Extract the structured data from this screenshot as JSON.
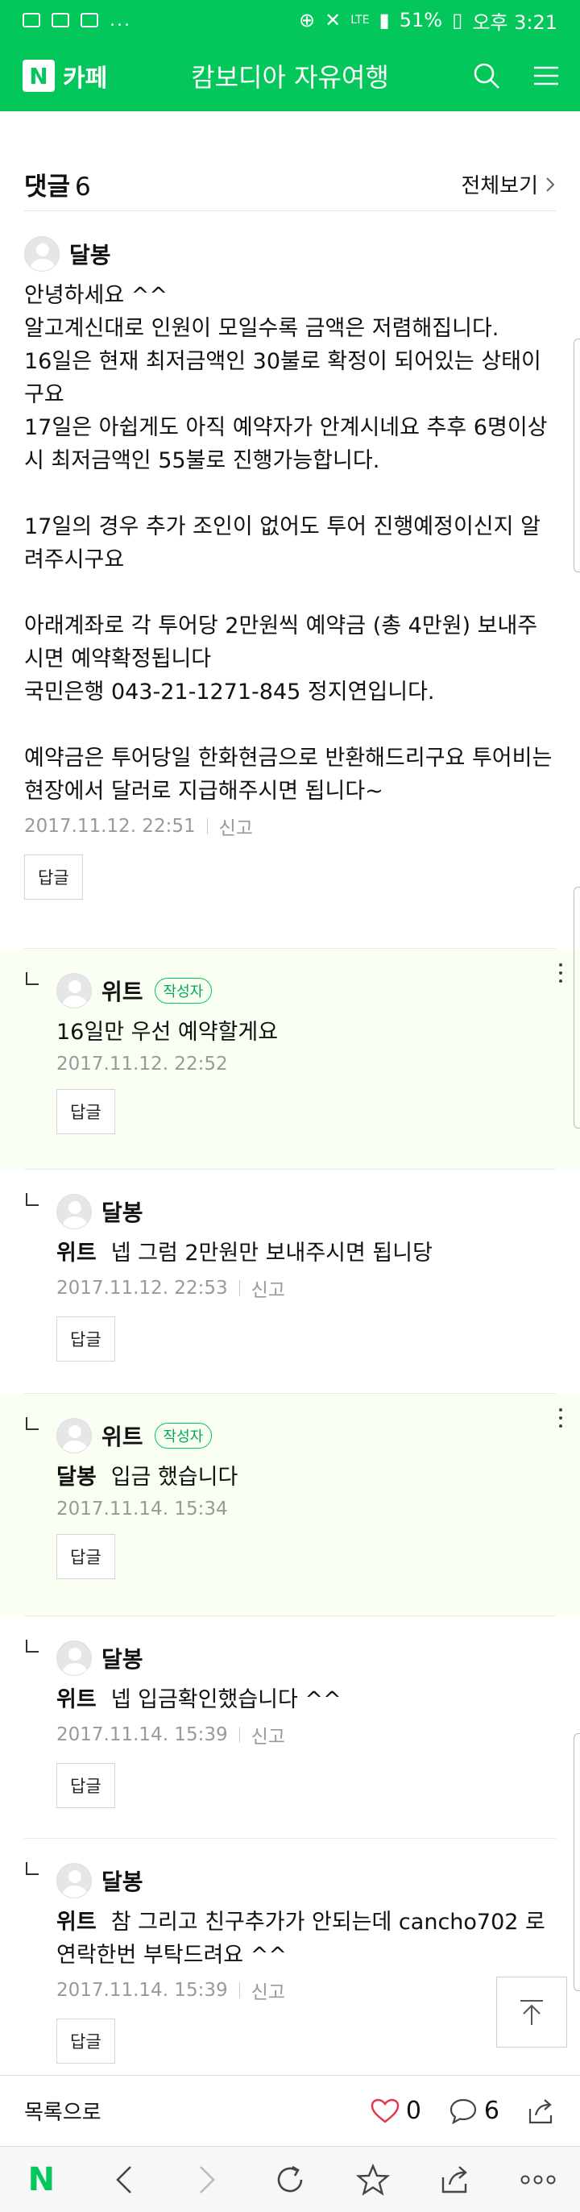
{
  "status_bar": {
    "dots": "...",
    "battery": "51%",
    "time": "오후 3:21",
    "lte": "LTE"
  },
  "header": {
    "cafe_label": "카페",
    "title": "캄보디아 자유여행"
  },
  "comments_header": {
    "title": "댓글",
    "count": "6",
    "view_all": "전체보기"
  },
  "comments": [
    {
      "nick": "달봉",
      "text": "안녕하세요 ^^\n알고계신대로 인원이 모일수록 금액은 저렴해집니다.\n16일은 현재 최저금액인 30불로 확정이 되어있는 상태이구요\n17일은 아쉽게도 아직 예약자가 안계시네요 추후 6명이상시 최저금액인 55불로 진행가능합니다.\n\n17일의 경우 추가 조인이 없어도 투어 진행예정이신지 알려주시구요\n\n아래계좌로 각 투어당 2만원씩 예약금 (총 4만원) 보내주시면 예약확정됩니다\n국민은행 043-21-1271-845 정지연입니다.\n\n예약금은 투어당일 한화현금으로 반환해드리구요 투어비는 현장에서 달러로 지급해주시면 됩니다~",
      "date": "2017.11.12. 22:51",
      "report": "신고",
      "reply": "답글"
    },
    {
      "nick": "위트",
      "badge": "작성자",
      "text": "16일만 우선 예약할게요",
      "date": "2017.11.12. 22:52",
      "reply": "답글"
    },
    {
      "nick": "달봉",
      "mention": "위트",
      "text": "넵 그럼 2만원만 보내주시면 됩니당",
      "date": "2017.11.12. 22:53",
      "report": "신고",
      "reply": "답글"
    },
    {
      "nick": "위트",
      "badge": "작성자",
      "mention": "달봉",
      "text": "입금 했습니다",
      "date": "2017.11.14. 15:34",
      "reply": "답글"
    },
    {
      "nick": "달봉",
      "mention": "위트",
      "text": "넵 입금확인했습니다 ^^",
      "date": "2017.11.14. 15:39",
      "report": "신고",
      "reply": "답글"
    },
    {
      "nick": "달봉",
      "mention": "위트",
      "text": "참 그리고 친구추가가 안되는데 cancho702 로 연락한번 부탁드려요 ^^",
      "date": "2017.11.14. 15:39",
      "report": "신고",
      "reply": "답글"
    }
  ],
  "bottom_bar": {
    "list_label": "목록으로",
    "likes": "0",
    "comments": "6"
  },
  "colors": {
    "brand": "#03c75a",
    "author_bg": "#fafff4"
  }
}
